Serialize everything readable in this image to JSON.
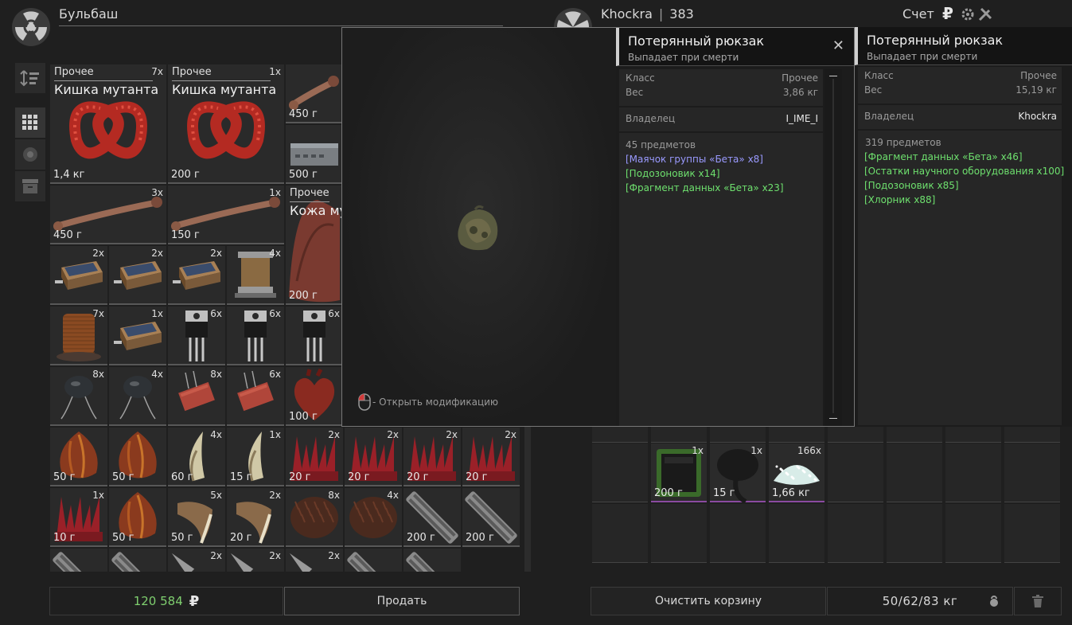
{
  "left": {
    "player_name": "Бульбаш",
    "money": "120 584",
    "currency": "₽",
    "sell_label": "Продать",
    "tools": [
      "sort-icon",
      "grid-icon",
      "filter-icon",
      "box-icon"
    ]
  },
  "grid": [
    {
      "cat": "Прочее",
      "title": "Кишка мутанта",
      "count": "7x",
      "weight": "1,4 кг",
      "art": "gut"
    },
    {
      "cat": "Прочее",
      "title": "Кишка мутанта",
      "count": "1x",
      "weight": "200 г",
      "art": "gut"
    },
    {
      "count": "",
      "weight": "450 г",
      "art": "bone"
    },
    {
      "count": "",
      "weight": "500 г",
      "art": "device"
    },
    {
      "count": "3x",
      "weight": "450 г",
      "art": "bone"
    },
    {
      "count": "1x",
      "weight": "150 г",
      "art": "bone"
    },
    {
      "cat": "Прочее",
      "title": "Кожа му",
      "count": "",
      "weight": "200 г",
      "art": "skin"
    },
    {
      "count": "2x",
      "weight": "",
      "art": "solar"
    },
    {
      "count": "2x",
      "weight": "",
      "art": "solar"
    },
    {
      "count": "2x",
      "weight": "",
      "art": "solar"
    },
    {
      "count": "4x",
      "weight": "",
      "art": "transformer"
    },
    {
      "count": "7x",
      "weight": "",
      "art": "coil"
    },
    {
      "count": "1x",
      "weight": "",
      "art": "solar"
    },
    {
      "count": "6x",
      "weight": "",
      "art": "transistor"
    },
    {
      "count": "6x",
      "weight": "",
      "art": "transistor"
    },
    {
      "count": "6x",
      "weight": "",
      "art": "transistor"
    },
    {
      "count": "8x",
      "weight": "",
      "art": "cap"
    },
    {
      "count": "4x",
      "weight": "",
      "art": "cap"
    },
    {
      "count": "8x",
      "weight": "",
      "art": "resistor"
    },
    {
      "count": "6x",
      "weight": "",
      "art": "resistor"
    },
    {
      "count": "",
      "weight": "100 г",
      "art": "heart"
    },
    {
      "count": "",
      "weight": "50 г",
      "art": "bulb"
    },
    {
      "count": "",
      "weight": "50 г",
      "art": "bulb"
    },
    {
      "count": "4x",
      "weight": "60 г",
      "art": "claw"
    },
    {
      "count": "1x",
      "weight": "15 г",
      "art": "claw"
    },
    {
      "count": "2x",
      "weight": "20 г",
      "art": "spikes"
    },
    {
      "count": "2x",
      "weight": "20 г",
      "art": "spikes"
    },
    {
      "count": "2x",
      "weight": "20 г",
      "art": "spikes"
    },
    {
      "count": "2x",
      "weight": "20 г",
      "art": "spikes"
    },
    {
      "count": "1x",
      "weight": "10 г",
      "art": "spikes"
    },
    {
      "count": "",
      "weight": "50 г",
      "art": "bulb"
    },
    {
      "count": "5x",
      "weight": "50 г",
      "art": "claw2"
    },
    {
      "count": "2x",
      "weight": "20 г",
      "art": "claw2"
    },
    {
      "count": "8x",
      "weight": "",
      "art": "fur"
    },
    {
      "count": "4x",
      "weight": "",
      "art": "fur"
    },
    {
      "count": "",
      "weight": "200 г",
      "art": "multitool"
    },
    {
      "count": "",
      "weight": "200 г",
      "art": "multitool"
    },
    {
      "count": "",
      "weight": "",
      "art": "multitool"
    },
    {
      "count": "",
      "weight": "",
      "art": "multitool"
    },
    {
      "count": "2x",
      "weight": "",
      "art": "knife"
    },
    {
      "count": "2x",
      "weight": "",
      "art": "knife"
    },
    {
      "count": "2x",
      "weight": "",
      "art": "knife"
    },
    {
      "count": "",
      "weight": "",
      "art": "multitool"
    },
    {
      "count": "",
      "weight": "",
      "art": "multitool"
    }
  ],
  "right": {
    "trader_name": "Khockra",
    "separator": "|",
    "level": "383",
    "score_label": "Счет",
    "clear_label": "Очистить корзину",
    "weight": "50/62/83 кг",
    "items": [
      {
        "count": "1x",
        "weight": "200 г",
        "art": "pda"
      },
      {
        "count": "1x",
        "weight": "15 г",
        "art": "mushroom"
      },
      {
        "count": "166x",
        "weight": "1,66 кг",
        "art": "crystal"
      }
    ]
  },
  "popup": {
    "hint": "- Открыть модификацию",
    "card1": {
      "title": "Потерянный рюкзак",
      "subtitle": "Выпадает при смерти",
      "class_label": "Класс",
      "class_value": "Прочее",
      "weight_label": "Вес",
      "weight_value": "3,86 кг",
      "owner_label": "Владелец",
      "owner_value": "I_IME_I",
      "count_label": "45 предметов",
      "items": [
        {
          "text": "[Маячок группы «Бета» x8]",
          "color": "#9a9aff"
        },
        {
          "text": "[Подозоновик x14]",
          "color": "#6ee06e"
        },
        {
          "text": "[Фрагмент данных «Бета» x23]",
          "color": "#6ee06e"
        }
      ]
    },
    "card2": {
      "title": "Потерянный рюкзак",
      "subtitle": "Выпадает при смерти",
      "class_label": "Класс",
      "class_value": "Прочее",
      "weight_label": "Вес",
      "weight_value": "15,19 кг",
      "owner_label": "Владелец",
      "owner_value": "Khockra",
      "count_label": "319 предметов",
      "items": [
        {
          "text": "[Фрагмент данных «Бета» x46]",
          "color": "#6ee06e"
        },
        {
          "text": "[Остатки научного оборудования x100]",
          "color": "#6ee06e"
        },
        {
          "text": "[Подозоновик x85]",
          "color": "#6ee06e"
        },
        {
          "text": "[Хлорник x88]",
          "color": "#6ee06e"
        }
      ]
    }
  }
}
